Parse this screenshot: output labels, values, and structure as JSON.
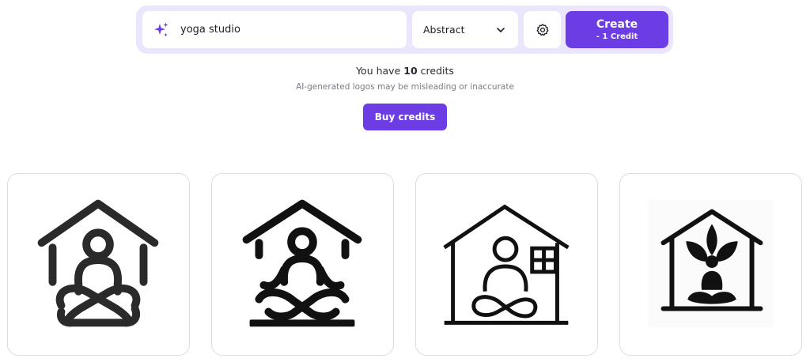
{
  "prompt": {
    "value": "yoga studio",
    "icon": "sparkle-icon"
  },
  "style_select": {
    "selected": "Abstract",
    "icon": "chevron-down-icon"
  },
  "settings": {
    "icon": "gear-icon"
  },
  "create_button": {
    "label": "Create",
    "cost": "- 1 Credit"
  },
  "credits": {
    "prefix": "You have",
    "count": "10",
    "suffix": "credits"
  },
  "disclaimer": "AI-generated logos may be misleading or inaccurate",
  "buy_button": {
    "label": "Buy credits"
  },
  "logos": [
    {
      "name": "logo-house-meditation-rounded"
    },
    {
      "name": "logo-house-meditation-bold"
    },
    {
      "name": "logo-house-meditation-window"
    },
    {
      "name": "logo-house-meditation-lotus"
    }
  ],
  "colors": {
    "accent": "#6c3ce5",
    "bar_background": "#ebe6fd",
    "icon_dark": "#1a1a1a"
  }
}
